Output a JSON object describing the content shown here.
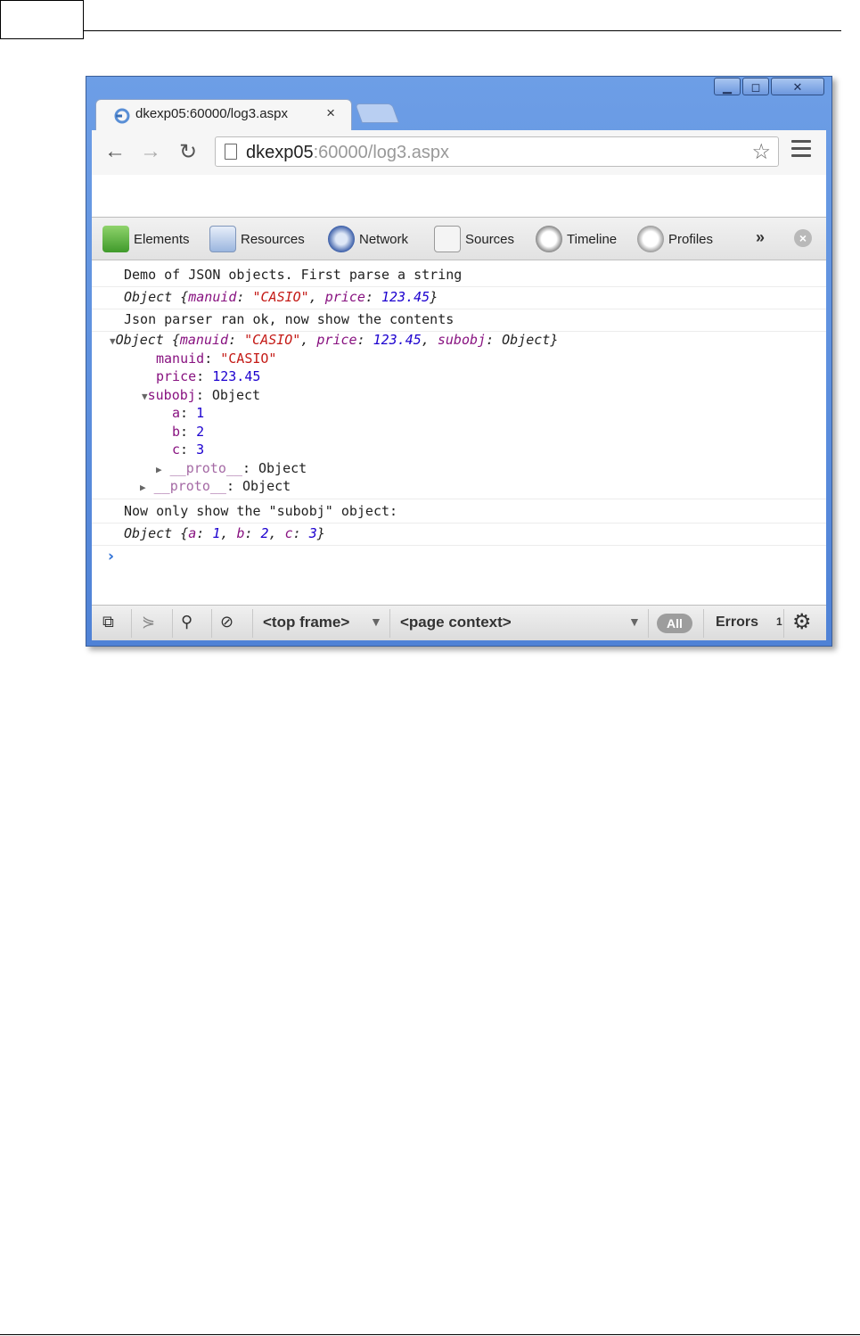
{
  "browser": {
    "tab_title": "dkexp05:60000/log3.aspx",
    "tab_close": "×",
    "url_host": "dkexp05",
    "url_rest": ":60000/log3.aspx",
    "window_buttons": {
      "minimize": "▁",
      "maximize": "◻",
      "close": "✕"
    }
  },
  "devtools": {
    "tabs": [
      {
        "label": "Elements",
        "icon": "elements-icon"
      },
      {
        "label": "Resources",
        "icon": "resources-icon"
      },
      {
        "label": "Network",
        "icon": "network-icon"
      },
      {
        "label": "Sources",
        "icon": "sources-icon"
      },
      {
        "label": "Timeline",
        "icon": "timeline-icon"
      },
      {
        "label": "Profiles",
        "icon": "profiles-icon"
      }
    ],
    "more": "»"
  },
  "console": {
    "line1": "Demo of JSON objects. First parse a string",
    "line2": {
      "obj": "Object {",
      "k1": "manuid",
      "v1": "\"CASIO\"",
      "k2": "price",
      "v2": "123.45",
      "end": "}"
    },
    "line3": "Json parser ran ok, now show the contents",
    "line4": {
      "obj": "Object {",
      "k1": "manuid",
      "v1": "\"CASIO\"",
      "k2": "price",
      "v2": "123.45",
      "k3": "subobj",
      "v3": "Object",
      "end": "}"
    },
    "props": [
      {
        "key": "manuid",
        "value": "\"CASIO\""
      },
      {
        "key": "price",
        "value": "123.45"
      }
    ],
    "subobj": {
      "key": "subobj",
      "value": "Object"
    },
    "sub_props": [
      {
        "key": "a",
        "value": "1"
      },
      {
        "key": "b",
        "value": "2"
      },
      {
        "key": "c",
        "value": "3"
      }
    ],
    "proto_inner": {
      "key": "__proto__",
      "value": "Object"
    },
    "proto_outer": {
      "key": "__proto__",
      "value": "Object"
    },
    "line5": "Now only show the \"subobj\" object:",
    "line6": {
      "obj": "Object {",
      "k1": "a",
      "v1": "1",
      "k2": "b",
      "v2": "2",
      "k3": "c",
      "v3": "3",
      "end": "}"
    },
    "prompt": "›"
  },
  "statusbar": {
    "frame": "<top frame>",
    "context": "<page context>",
    "all": "All",
    "errors": "Errors",
    "truncated": "1"
  },
  "colors": {
    "key": "#881280",
    "string": "#c41a16",
    "number": "#1c00cf",
    "prompt": "#2d70d6"
  }
}
